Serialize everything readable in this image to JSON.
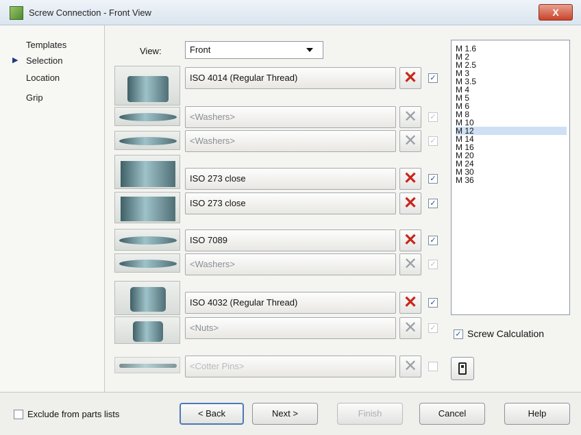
{
  "window": {
    "title": "Screw Connection - Front View",
    "close_label": "X"
  },
  "nav": {
    "items": [
      {
        "label": "Templates",
        "active": false
      },
      {
        "label": "Selection",
        "active": true
      },
      {
        "label": "Location",
        "active": false
      },
      {
        "label": "Grip",
        "active": false
      }
    ]
  },
  "view": {
    "label": "View:",
    "value": "Front"
  },
  "rows": [
    {
      "name": "head",
      "text": "ISO 4014  (Regular Thread)",
      "state": "active",
      "checked": true
    },
    {
      "name": "washer-1",
      "text": "<Washers>",
      "state": "empty",
      "checked": true
    },
    {
      "name": "washer-2",
      "text": "<Washers>",
      "state": "empty",
      "checked": true
    },
    {
      "name": "hole-1",
      "text": "ISO 273 close",
      "state": "active",
      "checked": true
    },
    {
      "name": "hole-2",
      "text": "ISO 273 close",
      "state": "active",
      "checked": true
    },
    {
      "name": "washer-3",
      "text": "ISO 7089",
      "state": "active",
      "checked": true
    },
    {
      "name": "washer-4",
      "text": "<Washers>",
      "state": "empty",
      "checked": true
    },
    {
      "name": "nut-1",
      "text": "ISO 4032  (Regular Thread)",
      "state": "active",
      "checked": true
    },
    {
      "name": "nut-2",
      "text": "<Nuts>",
      "state": "empty",
      "checked": true
    },
    {
      "name": "cotter-pin",
      "text": "<Cotter Pins>",
      "state": "disabled",
      "checked": false
    }
  ],
  "sizes": {
    "items": [
      "M 1.6",
      "M 2",
      "M 2.5",
      "M 3",
      "M 3.5",
      "M 4",
      "M 5",
      "M 6",
      "M 8",
      "M 10",
      "M 12",
      "M 14",
      "M 16",
      "M 20",
      "M 24",
      "M 30",
      "M 36"
    ],
    "selected": "M 12"
  },
  "screw_calculation": {
    "label": "Screw Calculation",
    "checked": true
  },
  "footer": {
    "exclude_label": "Exclude from parts lists",
    "back": "< Back",
    "next": "Next >",
    "finish": "Finish",
    "cancel": "Cancel",
    "help": "Help"
  }
}
